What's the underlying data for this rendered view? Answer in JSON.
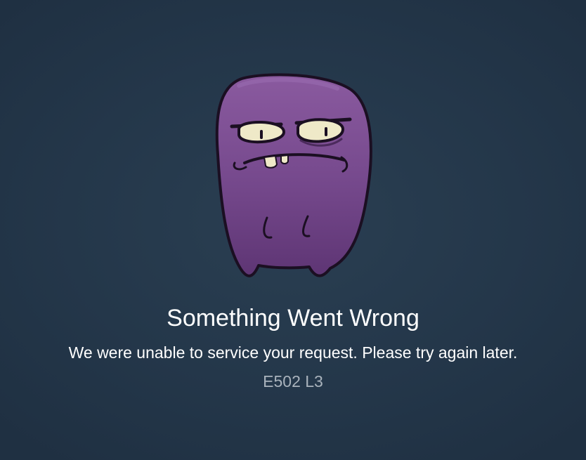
{
  "error": {
    "title": "Something Went Wrong",
    "message": "We were unable to service your request. Please try again later.",
    "code": "E502 L3"
  },
  "illustration": {
    "icon": "grumpy-purple-monster-illustration",
    "body_color": "#7b4b90",
    "outline_color": "#1b0f22"
  },
  "theme": {
    "background": "#253849",
    "text_primary": "#ffffff",
    "text_secondary": "#a9b3bc"
  }
}
